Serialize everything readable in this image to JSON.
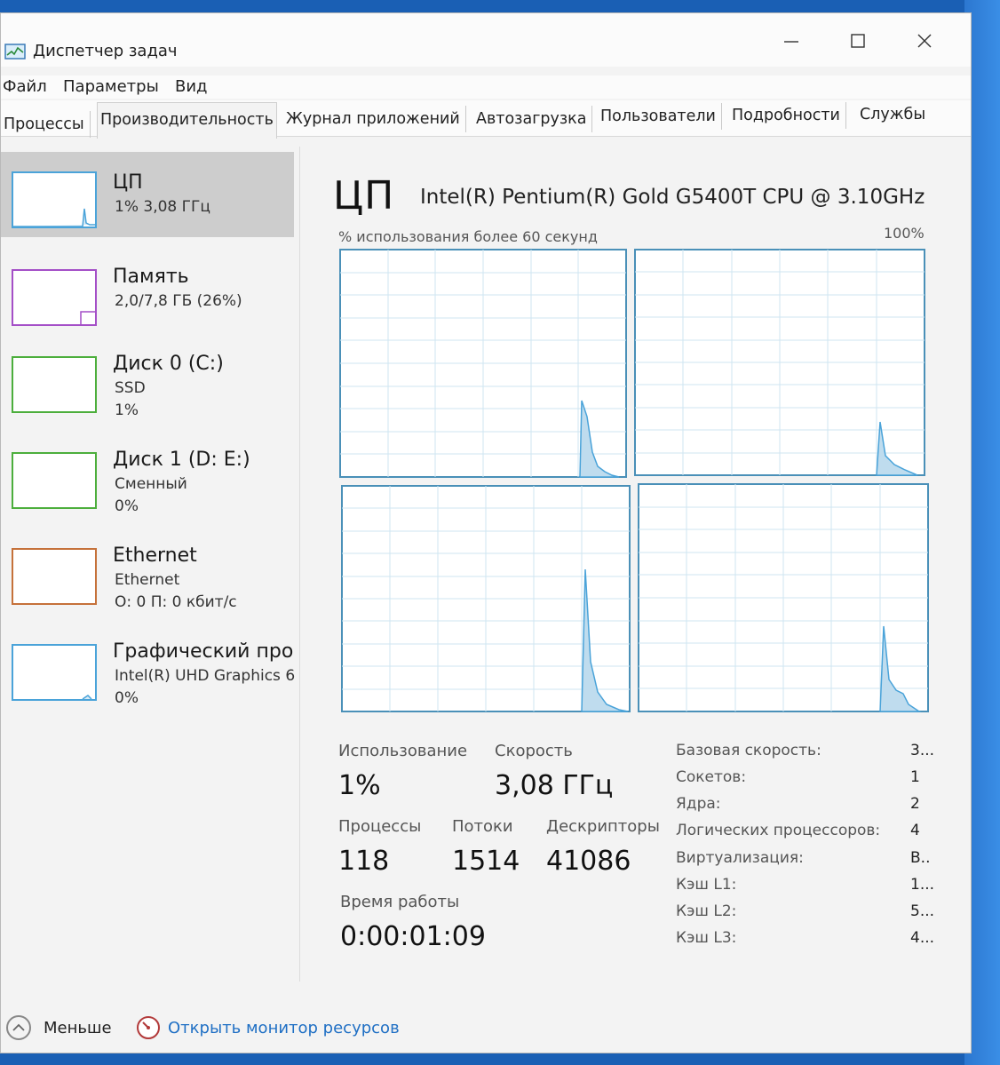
{
  "window": {
    "title": "Диспетчер задач"
  },
  "menu": [
    "Файл",
    "Параметры",
    "Вид"
  ],
  "tabs": [
    "Процессы",
    "Производительность",
    "Журнал приложений",
    "Автозагрузка",
    "Пользователи",
    "Подробности",
    "Службы"
  ],
  "active_tab": "Производительность",
  "sidebar": [
    {
      "title": "ЦП",
      "lines": [
        "1% 3,08 ГГц"
      ],
      "color": "#4aa3d9"
    },
    {
      "title": "Память",
      "lines": [
        "2,0/7,8 ГБ (26%)"
      ],
      "color": "#a44fc7"
    },
    {
      "title": "Диск 0 (C:)",
      "lines": [
        "SSD",
        "1%"
      ],
      "color": "#4cae3c"
    },
    {
      "title": "Диск 1 (D: E:)",
      "lines": [
        "Сменный",
        "0%"
      ],
      "color": "#4cae3c"
    },
    {
      "title": "Ethernet",
      "lines": [
        "Ethernet",
        "О: 0 П: 0 кбит/с"
      ],
      "color": "#c5713a"
    },
    {
      "title": "Графический про",
      "lines": [
        "Intel(R) UHD Graphics 6",
        "0%"
      ],
      "color": "#4aa3d9"
    }
  ],
  "cpu": {
    "heading": "ЦП",
    "model": "Intel(R) Pentium(R) Gold G5400T CPU @ 3.10GHz",
    "graph_caption": "% использования более 60 секунд",
    "graph_max": "100%"
  },
  "stats": {
    "usage": {
      "label": "Использование",
      "value": "1%"
    },
    "speed": {
      "label": "Скорость",
      "value": "3,08 ГГц"
    },
    "processes": {
      "label": "Процессы",
      "value": "118"
    },
    "threads": {
      "label": "Потоки",
      "value": "1514"
    },
    "handles": {
      "label": "Дескрипторы",
      "value": "41086"
    },
    "uptime": {
      "label": "Время работы",
      "value": "0:00:01:09"
    }
  },
  "details": [
    {
      "label": "Базовая скорость:",
      "value": "3..."
    },
    {
      "label": "Сокетов:",
      "value": "1"
    },
    {
      "label": "Ядра:",
      "value": "2"
    },
    {
      "label": "Логических процессоров:",
      "value": "4"
    },
    {
      "label": "Виртуализация:",
      "value": "В.."
    },
    {
      "label": "Кэш L1:",
      "value": "1..."
    },
    {
      "label": "Кэш L2:",
      "value": "5..."
    },
    {
      "label": "Кэш L3:",
      "value": "4..."
    }
  ],
  "footer": {
    "fewer": "Меньше",
    "monitor": "Открыть монитор ресурсов"
  },
  "colors": {
    "cpu_line": "#4aa3d9",
    "cpu_fill": "#bfdcee",
    "grid": "#cfe6f2",
    "link": "#1f6fc4"
  }
}
